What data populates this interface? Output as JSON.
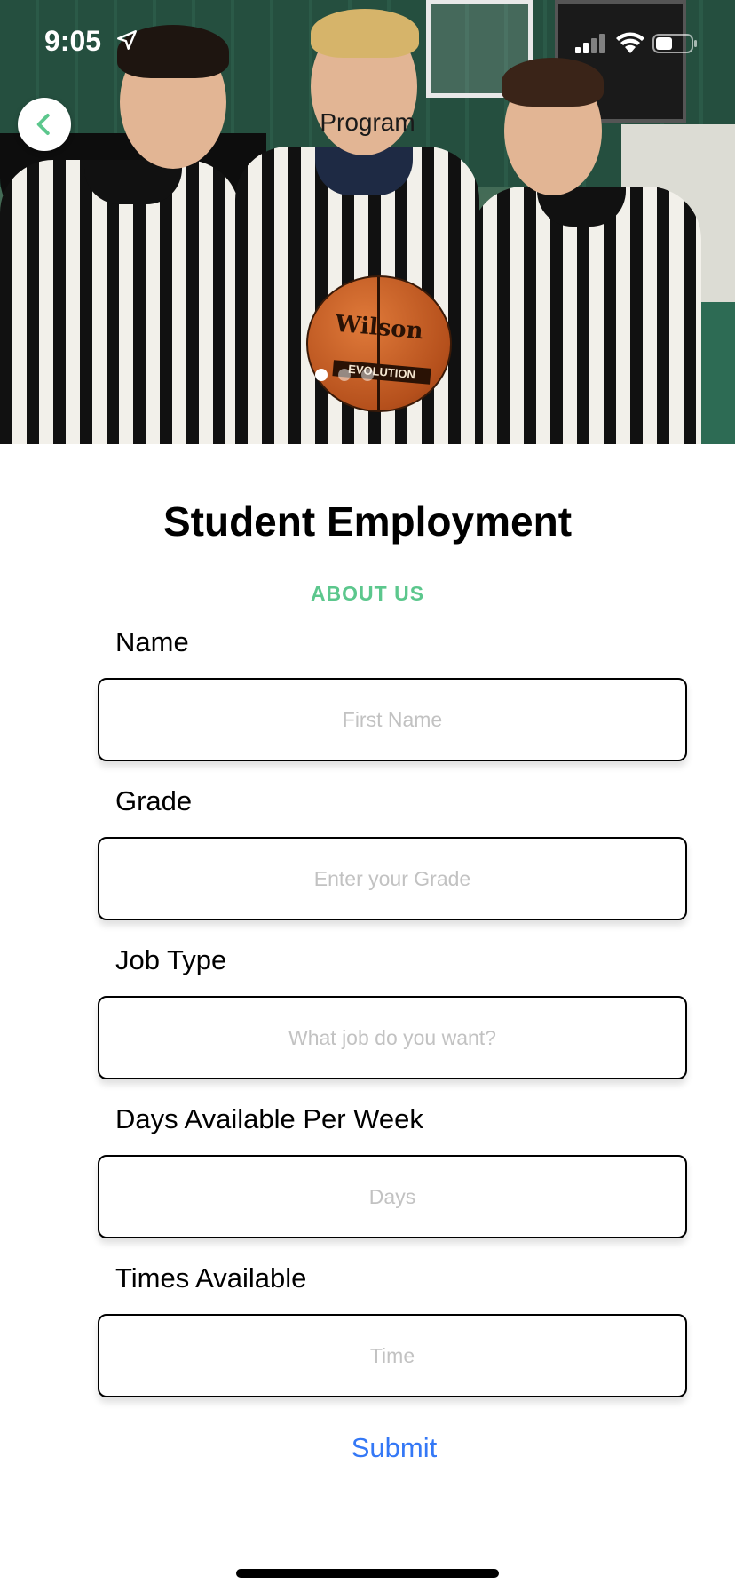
{
  "status_bar": {
    "time": "9:05",
    "location_icon": "location-arrow-icon",
    "signal_icon": "cellular-signal-icon",
    "wifi_icon": "wifi-icon",
    "battery_icon": "battery-icon"
  },
  "nav": {
    "title": "Program",
    "back_icon": "chevron-left-icon"
  },
  "hero": {
    "image": "three referees holding a basketball",
    "ball_brand": "Wilson",
    "ball_model": "EVOLUTION",
    "carousel_dots": 3,
    "active_dot": 0
  },
  "page": {
    "title": "Student Employment",
    "subtitle": "ABOUT US"
  },
  "form": {
    "fields": [
      {
        "label": "Name",
        "placeholder": "First Name"
      },
      {
        "label": "Grade",
        "placeholder": "Enter your Grade"
      },
      {
        "label": "Job Type",
        "placeholder": "What job do you want?"
      },
      {
        "label": "Days Available Per Week",
        "placeholder": "Days"
      },
      {
        "label": "Times Available",
        "placeholder": "Time"
      }
    ],
    "submit_label": "Submit"
  },
  "colors": {
    "accent": "#5cc78d",
    "link": "#3478f6"
  }
}
